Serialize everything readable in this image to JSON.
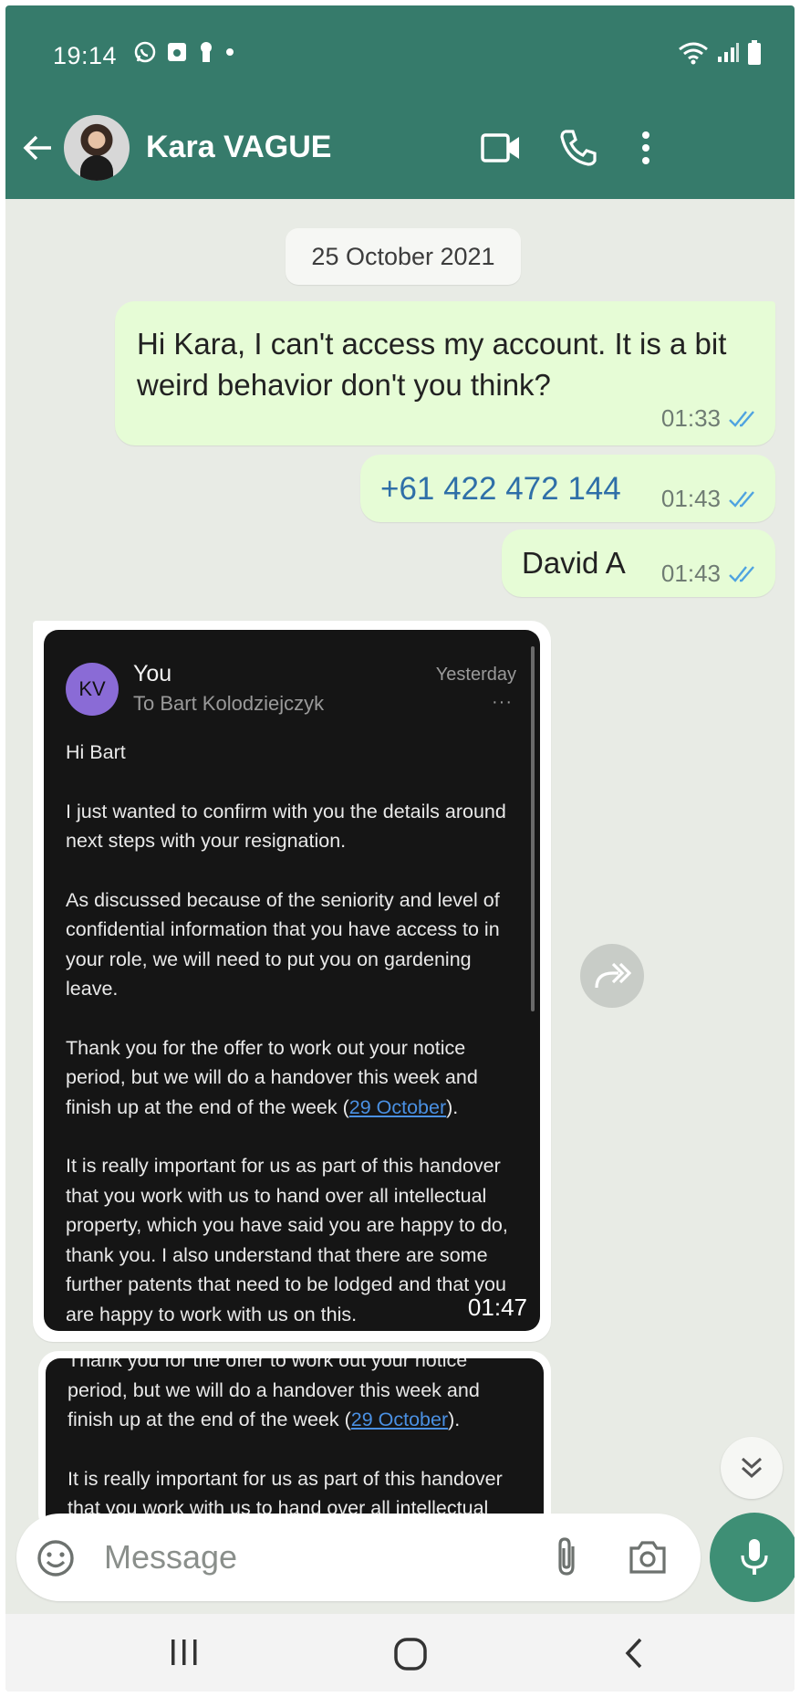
{
  "status_bar": {
    "time": "19:14"
  },
  "header": {
    "contact_name": "Kara VAGUE"
  },
  "chat": {
    "date_chip": "25 October 2021",
    "messages_out": [
      {
        "text": "Hi Kara, I can't access my account. It is a bit weird behavior don't you think?",
        "time": "01:33"
      },
      {
        "text": "+61 422 472 144",
        "time": "01:43"
      },
      {
        "text": "David A",
        "time": "01:43"
      }
    ],
    "image_message": {
      "time": "01:47",
      "email": {
        "avatar_initials": "KV",
        "sender": "You",
        "recipient": "To Bart Kolodziejczyk",
        "date": "Yesterday",
        "more": "···",
        "greeting": "Hi Bart",
        "p1": "I just wanted to confirm with you the details around next steps with your resignation.",
        "p2": "As discussed because of the seniority and level of confidential information that you have access to in your role, we will need to put you on gardening leave.",
        "p3_pre": "Thank you for the offer to work out your notice period, but we will do a handover this week and finish up at the end of the week (",
        "p3_link": "29 October",
        "p3_post": ").",
        "p4": "It is really important for us as part of this handover that you work with us to hand over all intellectual property, which you have said you are happy to do, thank you. I also understand that there are some further patents that need to be lodged and that you are happy to work with us on this."
      }
    },
    "image_message_2": {
      "p3_pre": "Thank you for the offer to work out your notice period, but we will do a handover this week and finish up at the end of the week (",
      "p3_link": "29 October",
      "p3_post": ").",
      "p4": "It is really important for us as part of this handover that you work with us to hand over all intellectual"
    }
  },
  "composer": {
    "placeholder": "Message"
  },
  "colors": {
    "header_bg": "#367b6b",
    "bubble_out": "#e6fcd6",
    "chat_bg": "#e8ebe5",
    "read_tick": "#4fa3e0",
    "mic_button": "#3e8f75"
  }
}
